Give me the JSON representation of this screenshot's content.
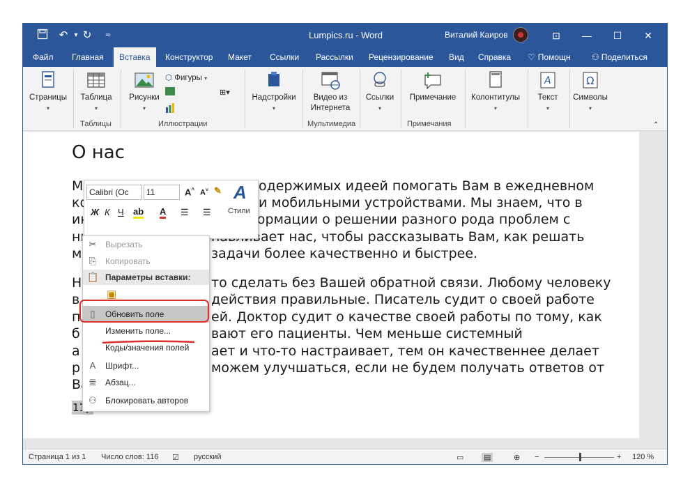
{
  "titlebar": {
    "title": "Lumpics.ru  -  Word",
    "user": "Виталий Каиров"
  },
  "tabs": [
    "Файл",
    "Главная",
    "Вставка",
    "Конструктор",
    "Макет",
    "Ссылки",
    "Рассылки",
    "Рецензирование",
    "Вид",
    "Справка",
    "Помощн",
    "Поделиться"
  ],
  "ribbon": {
    "pages": "Страницы",
    "table": "Таблица",
    "pictures": "Рисунки",
    "shapes": "Фигуры",
    "addins": "Надстройки",
    "video": "Видео из Интернета",
    "links": "Ссылки",
    "comment": "Примечание",
    "headers": "Колонтитулы",
    "text": "Текст",
    "symbols": "Символы",
    "group_tables": "Таблицы",
    "group_illustrations": "Иллюстрации",
    "group_multimedia": "Мультимедиа",
    "group_comments": "Примечания"
  },
  "document": {
    "heading": "О нас",
    "lines": [
      "М",
      "ко",
      "интернете уже полно информации о решении разного рода проблем с",
      "ни",
      "м",
      "Н",
      "в",
      "п",
      "б",
      "а",
      "р",
      "Ва"
    ],
    "right_fragments": [
      "одержимых идеей помогать Вам в ежедневном",
      "и мобильными устройствами. Мы знаем, что в",
      "навливает нас, чтобы рассказывать Вам, как решать",
      "задачи более качественно и быстрее.",
      "то сделать без Вашей обратной связи. Любому человеку",
      "действия правильные. Писатель судит о своей работе",
      "ей. Доктор судит о качестве своей работы по тому, как",
      "вают его пациенты. Чем меньше системный",
      "ает и что-то настраивает, тем он качественнее делает",
      "можем улучшаться, если не будем получать ответов от"
    ],
    "field_value": "11р"
  },
  "mini_toolbar": {
    "font": "Calibri (Ос",
    "size": "11",
    "styles": "Стили"
  },
  "context_menu": {
    "cut": "Вырезать",
    "copy": "Копировать",
    "paste_header": "Параметры вставки:",
    "update_field": "Обновить поле",
    "edit_field": "Изменить поле...",
    "toggle_codes": "Коды/значения полей",
    "font": "Шрифт...",
    "paragraph": "Абзац...",
    "block_authors": "Блокировать авторов"
  },
  "statusbar": {
    "page": "Страница 1 из 1",
    "words": "Число слов: 116",
    "language": "русский",
    "zoom": "120 %"
  },
  "colors": {
    "accent": "#2b579a",
    "highlight_ring": "#d9302a"
  }
}
